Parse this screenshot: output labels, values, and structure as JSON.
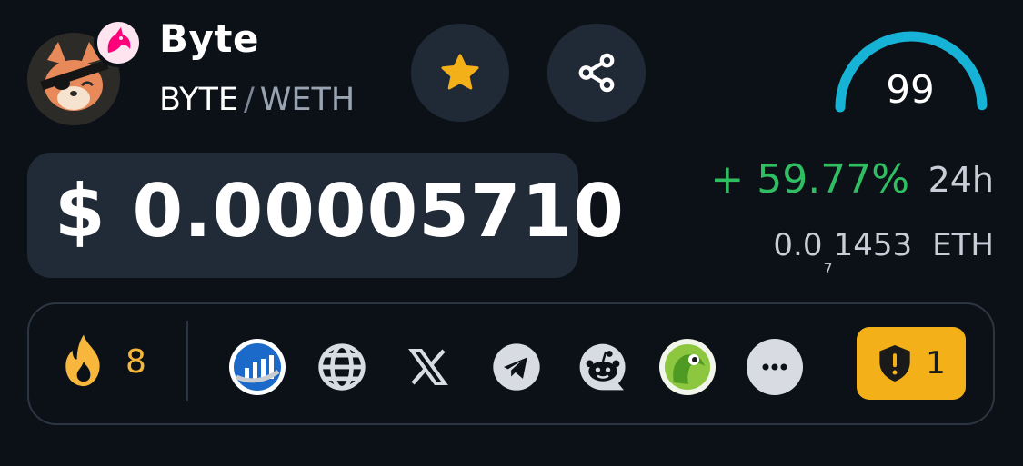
{
  "token": {
    "name": "Byte",
    "base_symbol": "BYTE",
    "separator": "/",
    "quote_symbol": "WETH",
    "avatar_icon": "fox-eyepatch-logo",
    "dex_badge_icon": "unicorn-icon"
  },
  "actions": {
    "favorite_icon": "star-icon",
    "share_icon": "share-icon"
  },
  "score": {
    "value": "99",
    "level_fraction": 0.99,
    "gauge_color": "#17b3d6"
  },
  "price": {
    "usd": "$ 0.00005710",
    "change": "+ 59.77%",
    "period": "24h",
    "eth_prefix": "0.0",
    "eth_zero_count": "7",
    "eth_digits": "1453",
    "eth_unit": "ETH"
  },
  "links": {
    "hot_count": "8",
    "items": [
      "coinmarketcap-icon",
      "website-globe-icon",
      "x-twitter-icon",
      "telegram-icon",
      "reddit-icon",
      "coingecko-icon",
      "more-icon"
    ],
    "audit_count": "1"
  },
  "colors": {
    "background": "#0c1117",
    "positive": "#2fbf62",
    "accent_orange": "#f6b73c",
    "audit_badge": "#f4b019"
  }
}
